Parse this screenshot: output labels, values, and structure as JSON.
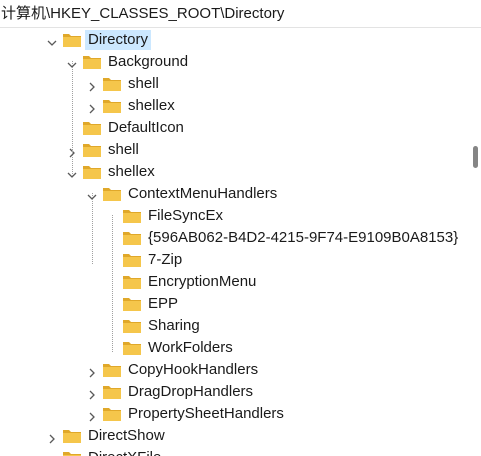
{
  "address": {
    "path": "计算机\\HKEY_CLASSES_ROOT\\Directory"
  },
  "tree": {
    "nodes": [
      {
        "label": "Directory",
        "depth": 0,
        "toggle": "expanded",
        "selected": true
      },
      {
        "label": "Background",
        "depth": 1,
        "toggle": "expanded"
      },
      {
        "label": "shell",
        "depth": 2,
        "toggle": "collapsed"
      },
      {
        "label": "shellex",
        "depth": 2,
        "toggle": "collapsed"
      },
      {
        "label": "DefaultIcon",
        "depth": 1,
        "toggle": "none"
      },
      {
        "label": "shell",
        "depth": 1,
        "toggle": "collapsed"
      },
      {
        "label": "shellex",
        "depth": 1,
        "toggle": "expanded"
      },
      {
        "label": "ContextMenuHandlers",
        "depth": 2,
        "toggle": "expanded"
      },
      {
        "label": " FileSyncEx",
        "depth": 3,
        "toggle": "none"
      },
      {
        "label": "{596AB062-B4D2-4215-9F74-E9109B0A8153}",
        "depth": 3,
        "toggle": "none"
      },
      {
        "label": "7-Zip",
        "depth": 3,
        "toggle": "none"
      },
      {
        "label": "EncryptionMenu",
        "depth": 3,
        "toggle": "none"
      },
      {
        "label": "EPP",
        "depth": 3,
        "toggle": "none"
      },
      {
        "label": "Sharing",
        "depth": 3,
        "toggle": "none"
      },
      {
        "label": "WorkFolders",
        "depth": 3,
        "toggle": "none"
      },
      {
        "label": "CopyHookHandlers",
        "depth": 2,
        "toggle": "collapsed"
      },
      {
        "label": "DragDropHandlers",
        "depth": 2,
        "toggle": "collapsed"
      },
      {
        "label": "PropertySheetHandlers",
        "depth": 2,
        "toggle": "collapsed"
      },
      {
        "label": "DirectShow",
        "depth": 0,
        "toggle": "collapsed"
      },
      {
        "label": "DirectXFile",
        "depth": 0,
        "toggle": "collapsed"
      }
    ]
  },
  "colors": {
    "folder": "#f5c64b",
    "folder_dark": "#e0a82a",
    "selection": "#cce8ff",
    "chevron": "#5a5a5a"
  }
}
